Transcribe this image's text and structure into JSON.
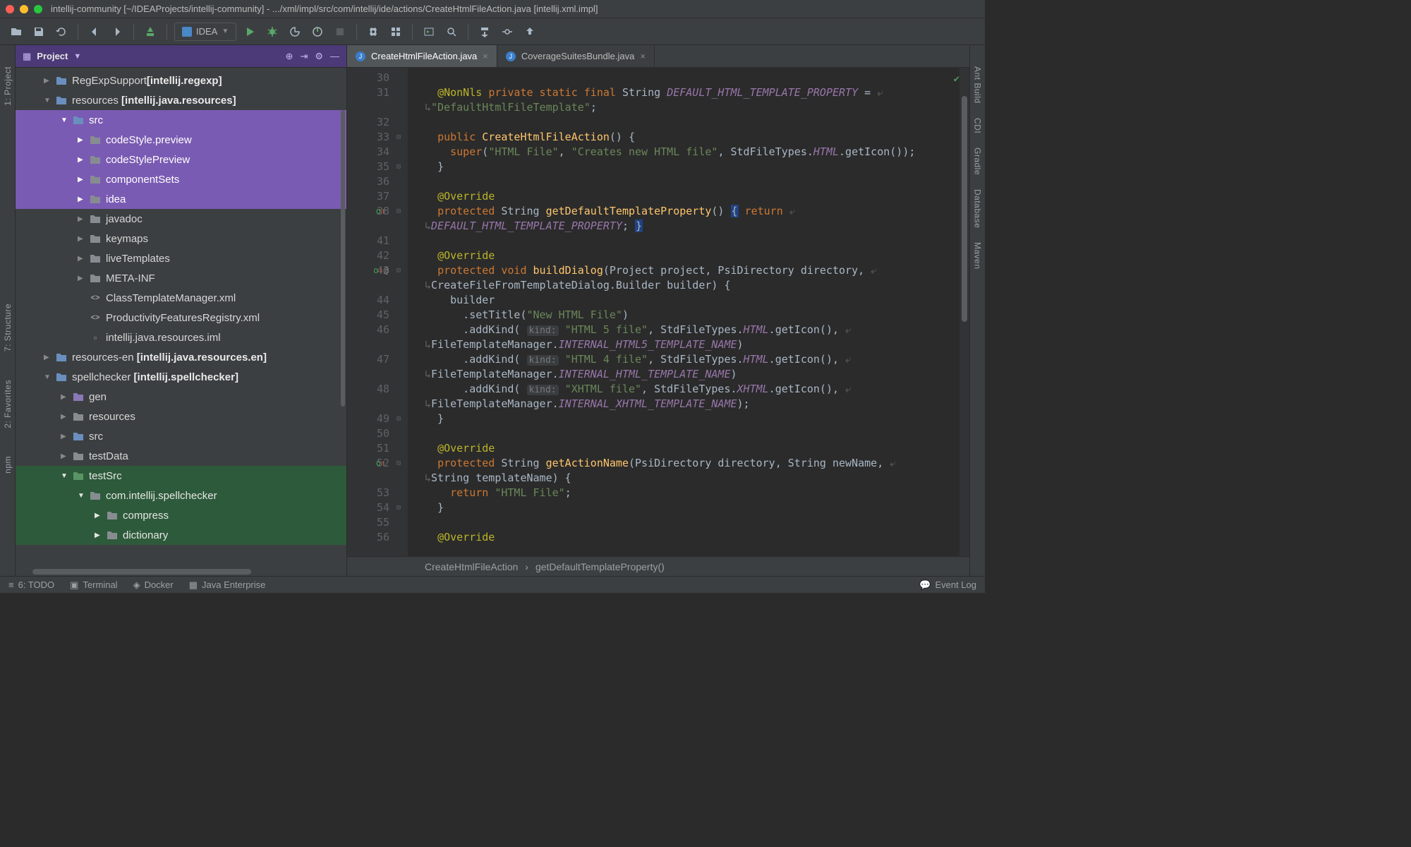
{
  "title": "intellij-community [~/IDEAProjects/intellij-community] - .../xml/impl/src/com/intellij/ide/actions/CreateHtmlFileAction.java [intellij.xml.impl]",
  "runconfig": "IDEA",
  "project_header": "Project",
  "left_tools": [
    "1: Project",
    "7: Structure",
    "2: Favorites",
    "npm"
  ],
  "right_tools": [
    "Ant Build",
    "CDI",
    "Gradle",
    "Database",
    "Maven"
  ],
  "tabs": [
    {
      "label": "CreateHtmlFileAction.java",
      "active": true
    },
    {
      "label": "CoverageSuitesBundle.java",
      "active": false
    }
  ],
  "tree": [
    {
      "ind": 40,
      "chev": "▶",
      "icon": "folder-blue",
      "label": "RegExpSupport",
      "bold": "[intellij.regexp]",
      "sel": ""
    },
    {
      "ind": 40,
      "chev": "▼",
      "icon": "folder-blue",
      "label": "resources ",
      "bold": "[intellij.java.resources]",
      "sel": ""
    },
    {
      "ind": 64,
      "chev": "▼",
      "icon": "folder-blue",
      "label": "src",
      "bold": "",
      "sel": "sel-purple"
    },
    {
      "ind": 88,
      "chev": "▶",
      "icon": "folder-grey",
      "label": "codeStyle.preview",
      "bold": "",
      "sel": "sel-purple"
    },
    {
      "ind": 88,
      "chev": "▶",
      "icon": "folder-grey",
      "label": "codeStylePreview",
      "bold": "",
      "sel": "sel-purple"
    },
    {
      "ind": 88,
      "chev": "▶",
      "icon": "folder-grey",
      "label": "componentSets",
      "bold": "",
      "sel": "sel-purple"
    },
    {
      "ind": 88,
      "chev": "▶",
      "icon": "folder-grey",
      "label": "idea",
      "bold": "",
      "sel": "sel-purple"
    },
    {
      "ind": 88,
      "chev": "▶",
      "icon": "folder-grey",
      "label": "javadoc",
      "bold": "",
      "sel": ""
    },
    {
      "ind": 88,
      "chev": "▶",
      "icon": "folder-grey",
      "label": "keymaps",
      "bold": "",
      "sel": ""
    },
    {
      "ind": 88,
      "chev": "▶",
      "icon": "folder-grey",
      "label": "liveTemplates",
      "bold": "",
      "sel": ""
    },
    {
      "ind": 88,
      "chev": "▶",
      "icon": "folder-grey",
      "label": "META-INF",
      "bold": "",
      "sel": ""
    },
    {
      "ind": 88,
      "chev": "",
      "icon": "xml",
      "label": "ClassTemplateManager.xml",
      "bold": "",
      "sel": ""
    },
    {
      "ind": 88,
      "chev": "",
      "icon": "xml",
      "label": "ProductivityFeaturesRegistry.xml",
      "bold": "",
      "sel": ""
    },
    {
      "ind": 88,
      "chev": "",
      "icon": "iml",
      "label": "intellij.java.resources.iml",
      "bold": "",
      "sel": ""
    },
    {
      "ind": 40,
      "chev": "▶",
      "icon": "folder-blue",
      "label": "resources-en ",
      "bold": "[intellij.java.resources.en]",
      "sel": ""
    },
    {
      "ind": 40,
      "chev": "▼",
      "icon": "folder-blue",
      "label": "spellchecker ",
      "bold": "[intellij.spellchecker]",
      "sel": ""
    },
    {
      "ind": 64,
      "chev": "▶",
      "icon": "folder-purple",
      "label": "gen",
      "bold": "",
      "sel": ""
    },
    {
      "ind": 64,
      "chev": "▶",
      "icon": "folder-grey",
      "label": "resources",
      "bold": "",
      "sel": ""
    },
    {
      "ind": 64,
      "chev": "▶",
      "icon": "folder-blue",
      "label": "src",
      "bold": "",
      "sel": ""
    },
    {
      "ind": 64,
      "chev": "▶",
      "icon": "folder-grey",
      "label": "testData",
      "bold": "",
      "sel": ""
    },
    {
      "ind": 64,
      "chev": "▼",
      "icon": "folder-green",
      "label": "testSrc",
      "bold": "",
      "sel": "sel-green"
    },
    {
      "ind": 88,
      "chev": "▼",
      "icon": "folder-grey",
      "label": "com.intellij.spellchecker",
      "bold": "",
      "sel": "sel-green"
    },
    {
      "ind": 112,
      "chev": "▶",
      "icon": "folder-grey",
      "label": "compress",
      "bold": "",
      "sel": "sel-green"
    },
    {
      "ind": 112,
      "chev": "▶",
      "icon": "folder-grey",
      "label": "dictionary",
      "bold": "",
      "sel": "sel-green"
    }
  ],
  "gutter_lines": [
    "30",
    "31",
    "",
    "32",
    "33",
    "34",
    "35",
    "36",
    "37",
    "38",
    "",
    "41",
    "42",
    "43",
    "",
    "44",
    "45",
    "46",
    "",
    "47",
    "",
    "48",
    "",
    "49",
    "50",
    "51",
    "52",
    "",
    "53",
    "54",
    "55",
    "56"
  ],
  "fold_lines": [
    "",
    "",
    "",
    "",
    "-",
    "",
    "-",
    "",
    "",
    "-",
    "",
    "",
    "",
    "-",
    "",
    "",
    "",
    "",
    "",
    "",
    "",
    "",
    "",
    "-",
    "",
    "",
    "-",
    "",
    "",
    "-",
    "",
    ""
  ],
  "ann_lines": [
    "",
    "",
    "",
    "",
    "",
    "",
    "",
    "",
    "",
    "o↑",
    "",
    "",
    "",
    "o↑ @",
    "",
    "",
    "",
    "",
    "",
    "",
    "",
    "",
    "",
    "",
    "",
    "",
    "o↑",
    "",
    "",
    "",
    "",
    ""
  ],
  "code": [
    "",
    "  <span class='ann'>@NonNls</span> <span class='k'>private static final</span> String <span class='c-it'>DEFAULT_HTML_TEMPLATE_PROPERTY</span> = <span class='wrap-mark'>⤶</span>",
    "<span class='wrap-mark'>↳</span><span class='s'>\"DefaultHtmlFileTemplate\"</span>;",
    "",
    "  <span class='k'>public</span> <span class='m'>CreateHtmlFileAction</span>() {",
    "    <span class='k'>super</span>(<span class='s'>\"HTML File\"</span>, <span class='s'>\"Creates new HTML file\"</span>, StdFileTypes.<span class='c-it'>HTML</span>.getIcon());",
    "  }",
    "",
    "  <span class='ann'>@Override</span>",
    "  <span class='k'>protected</span> String <span class='m'>getDefaultTemplateProperty</span>() <span class='hl-box'>{</span> <span class='k'>return</span> <span class='wrap-mark'>⤶</span>",
    "<span class='wrap-mark'>↳</span><span class='c-it'>DEFAULT_HTML_TEMPLATE_PROPERTY</span>; <span class='hl-box'>}</span>",
    "",
    "  <span class='ann'>@Override</span>",
    "  <span class='k'>protected void</span> <span class='m'>buildDialog</span>(Project project, PsiDirectory directory, <span class='wrap-mark'>⤶</span>",
    "<span class='wrap-mark'>↳</span>CreateFileFromTemplateDialog.Builder builder) {",
    "    builder",
    "      .setTitle(<span class='s'>\"New HTML File\"</span>)",
    "      .addKind( <span class='hint'>kind:</span> <span class='s'>\"HTML 5 file\"</span>, StdFileTypes.<span class='c-it'>HTML</span>.getIcon(), <span class='wrap-mark'>⤶</span>",
    "<span class='wrap-mark'>↳</span>FileTemplateManager.<span class='c-it'>INTERNAL_HTML5_TEMPLATE_NAME</span>)",
    "      .addKind( <span class='hint'>kind:</span> <span class='s'>\"HTML 4 file\"</span>, StdFileTypes.<span class='c-it'>HTML</span>.getIcon(), <span class='wrap-mark'>⤶</span>",
    "<span class='wrap-mark'>↳</span>FileTemplateManager.<span class='c-it'>INTERNAL_HTML_TEMPLATE_NAME</span>)",
    "      .addKind( <span class='hint'>kind:</span> <span class='s'>\"XHTML file\"</span>, StdFileTypes.<span class='c-it'>XHTML</span>.getIcon(), <span class='wrap-mark'>⤶</span>",
    "<span class='wrap-mark'>↳</span>FileTemplateManager.<span class='c-it'>INTERNAL_XHTML_TEMPLATE_NAME</span>);",
    "  }",
    "",
    "  <span class='ann'>@Override</span>",
    "  <span class='k'>protected</span> String <span class='m'>getActionName</span>(PsiDirectory directory, String newName, <span class='wrap-mark'>⤶</span>",
    "<span class='wrap-mark'>↳</span>String templateName) {",
    "    <span class='k'>return</span> <span class='s'>\"HTML File\"</span>;",
    "  }",
    "",
    "  <span class='ann'>@Override</span>"
  ],
  "breadcrumbs": [
    "CreateHtmlFileAction",
    "getDefaultTemplateProperty()"
  ],
  "status": {
    "todo": "6: TODO",
    "terminal": "Terminal",
    "docker": "Docker",
    "javaee": "Java Enterprise",
    "eventlog": "Event Log"
  }
}
